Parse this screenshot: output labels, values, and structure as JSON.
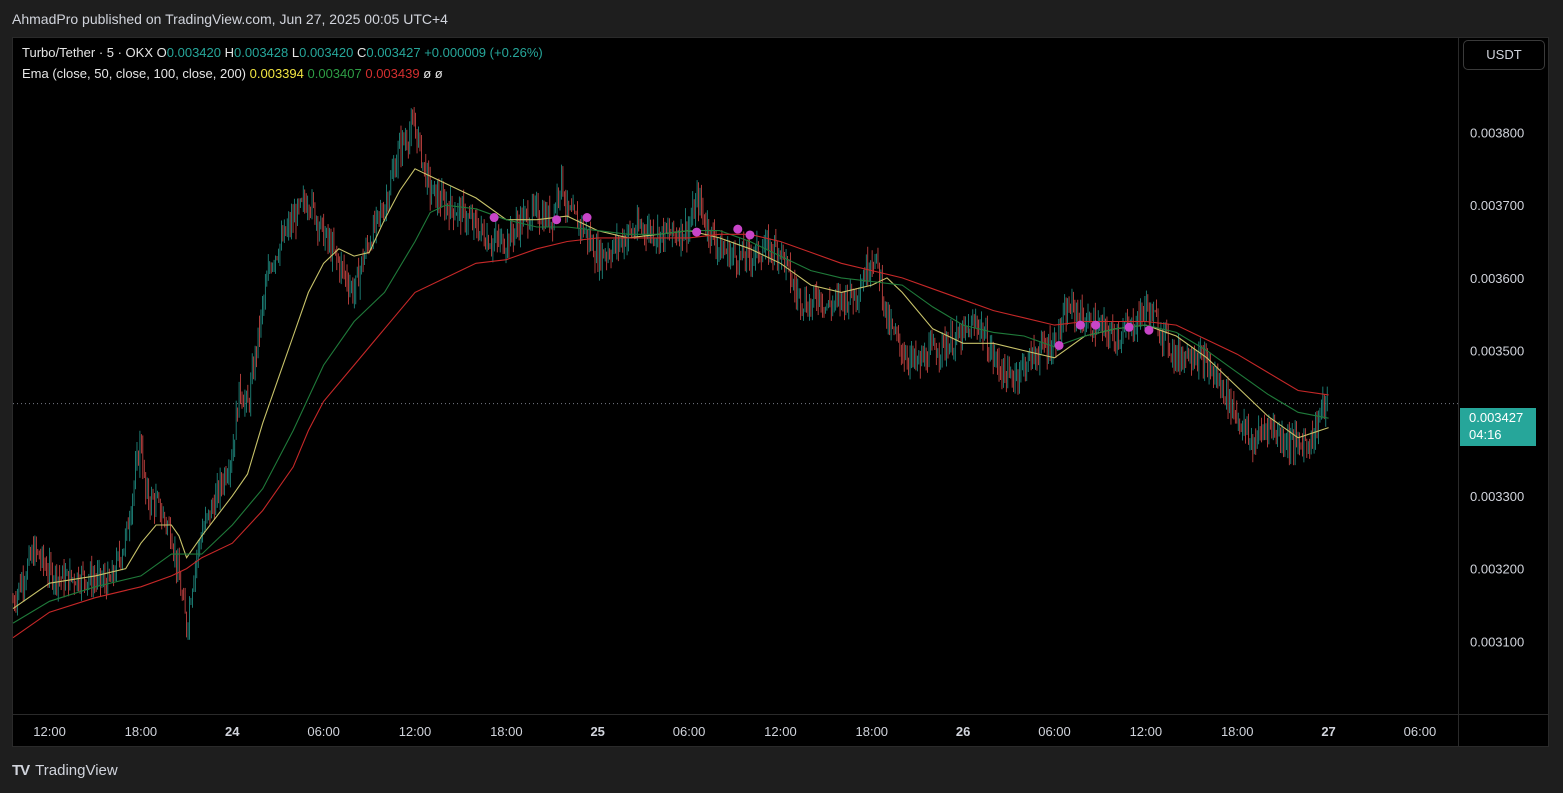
{
  "header": {
    "published": "AhmadPro published on TradingView.com, Jun 27, 2025 00:05 UTC+4"
  },
  "legend": {
    "symbol": "Turbo/Tether · 5 · OKX",
    "o_label": "O",
    "o_val": "0.003420",
    "h_label": "H",
    "h_val": "0.003428",
    "l_label": "L",
    "l_val": "0.003420",
    "c_label": "C",
    "c_val": "0.003427",
    "change": "+0.000009 (+0.26%)",
    "ema_label": "Ema (close, 50, close, 100, close, 200)",
    "ema50": "0.003394",
    "ema100": "0.003407",
    "ema200": "0.003439",
    "extra1": "ø",
    "extra2": "ø"
  },
  "currency_button": "USDT",
  "price_tag": {
    "price": "0.003427",
    "countdown": "04:16"
  },
  "footer": {
    "logo": "TV",
    "brand": "TradingView"
  },
  "colors": {
    "up": "#26a69a",
    "down": "#ef5350",
    "ema50": "#c8c36a",
    "ema100": "#1f7a3a",
    "ema200": "#c62828",
    "marker": "#c845c8",
    "background": "#000000"
  },
  "chart_data": {
    "type": "line",
    "title": "Turbo/Tether · 5 · OKX",
    "y_ticks": [
      "0.003800",
      "0.003700",
      "0.003600",
      "0.003500",
      "0.003300",
      "0.003200",
      "0.003100"
    ],
    "y_tick_values": [
      0.0038,
      0.0037,
      0.0036,
      0.0035,
      0.0033,
      0.0032,
      0.0031
    ],
    "x_ticks": [
      {
        "label": "12:00",
        "h": 12,
        "bold": false
      },
      {
        "label": "18:00",
        "h": 18,
        "bold": false
      },
      {
        "label": "24",
        "h": 24,
        "bold": true
      },
      {
        "label": "06:00",
        "h": 30,
        "bold": false
      },
      {
        "label": "12:00",
        "h": 36,
        "bold": false
      },
      {
        "label": "18:00",
        "h": 42,
        "bold": false
      },
      {
        "label": "25",
        "h": 48,
        "bold": true
      },
      {
        "label": "06:00",
        "h": 54,
        "bold": false
      },
      {
        "label": "12:00",
        "h": 60,
        "bold": false
      },
      {
        "label": "18:00",
        "h": 66,
        "bold": false
      },
      {
        "label": "26",
        "h": 72,
        "bold": true
      },
      {
        "label": "06:00",
        "h": 78,
        "bold": false
      },
      {
        "label": "12:00",
        "h": 84,
        "bold": false
      },
      {
        "label": "18:00",
        "h": 90,
        "bold": false
      },
      {
        "label": "27",
        "h": 96,
        "bold": true
      },
      {
        "label": "06:00",
        "h": 102,
        "bold": false
      }
    ],
    "x_range_hours": [
      9.6,
      104.5
    ],
    "y_range": [
      0.003,
      0.00393
    ],
    "current_price": 0.003427,
    "close_series": {
      "name": "Price",
      "h": [
        9.6,
        11,
        12,
        13,
        14,
        15,
        16,
        17,
        18,
        18.3,
        19,
        20,
        21,
        21.5,
        22,
        23,
        24,
        24.5,
        25,
        26,
        26.5,
        27,
        28,
        29,
        30,
        31,
        32,
        32.5,
        33,
        34,
        35,
        36,
        36.5,
        37,
        38,
        39,
        40,
        41,
        42,
        43,
        44,
        45,
        45.6,
        46,
        47,
        48,
        49,
        50,
        51,
        52,
        53,
        54,
        54.6,
        55,
        56,
        57,
        58,
        59,
        60,
        61,
        62,
        62.5,
        63,
        64,
        65,
        66,
        66.5,
        67,
        68,
        69,
        70,
        71,
        72,
        73,
        74,
        75,
        76,
        77,
        78,
        79,
        80,
        81,
        82,
        83,
        84,
        85,
        86,
        87,
        88,
        89,
        90,
        91,
        92,
        93,
        94,
        95,
        95.5,
        96
      ],
      "values": [
        0.003155,
        0.003225,
        0.003195,
        0.003185,
        0.00319,
        0.003185,
        0.00318,
        0.00324,
        0.00338,
        0.0033,
        0.00329,
        0.00325,
        0.00312,
        0.0032,
        0.00325,
        0.0033,
        0.00336,
        0.00345,
        0.00342,
        0.00356,
        0.00362,
        0.00364,
        0.00368,
        0.00371,
        0.00366,
        0.00362,
        0.00358,
        0.00362,
        0.00365,
        0.0037,
        0.00378,
        0.00381,
        0.00376,
        0.00372,
        0.0037,
        0.00369,
        0.00367,
        0.00365,
        0.00365,
        0.00368,
        0.00369,
        0.00368,
        0.00374,
        0.00369,
        0.00367,
        0.00363,
        0.00364,
        0.00366,
        0.00367,
        0.00366,
        0.00366,
        0.00367,
        0.00371,
        0.00368,
        0.00364,
        0.00363,
        0.00363,
        0.00364,
        0.00364,
        0.00358,
        0.00356,
        0.00358,
        0.00356,
        0.00357,
        0.00358,
        0.00363,
        0.00361,
        0.00354,
        0.0035,
        0.00348,
        0.0035,
        0.00351,
        0.00352,
        0.00354,
        0.00349,
        0.00346,
        0.00348,
        0.0035,
        0.00351,
        0.00356,
        0.00354,
        0.00353,
        0.00352,
        0.00353,
        0.00356,
        0.00353,
        0.00349,
        0.0035,
        0.00348,
        0.00345,
        0.00341,
        0.00337,
        0.0034,
        0.00338,
        0.00337,
        0.00338,
        0.00342,
        0.003427
      ]
    },
    "series": [
      {
        "name": "EMA 50",
        "h": [
          9.6,
          12,
          15,
          17,
          18,
          19,
          20,
          20.5,
          21,
          22,
          24,
          25,
          26,
          27,
          28,
          29,
          30,
          31,
          32,
          33,
          34,
          35,
          36,
          37,
          38,
          40,
          42,
          44,
          46,
          48,
          50,
          52,
          54,
          56,
          58,
          60,
          62,
          64,
          66,
          67,
          68,
          70,
          72,
          74,
          76,
          78,
          80,
          82,
          84,
          86,
          88,
          90,
          92,
          94,
          96
        ],
        "values": [
          0.003145,
          0.00318,
          0.00319,
          0.0032,
          0.003235,
          0.00326,
          0.00326,
          0.003245,
          0.003215,
          0.003245,
          0.0033,
          0.00333,
          0.0034,
          0.00346,
          0.00352,
          0.00358,
          0.00362,
          0.00364,
          0.00363,
          0.003635,
          0.00368,
          0.00372,
          0.00375,
          0.00374,
          0.00373,
          0.00371,
          0.00368,
          0.00368,
          0.003685,
          0.003665,
          0.003655,
          0.00366,
          0.003665,
          0.003655,
          0.00364,
          0.00362,
          0.00359,
          0.00358,
          0.00359,
          0.0036,
          0.00358,
          0.00353,
          0.00351,
          0.00351,
          0.0035,
          0.00349,
          0.00352,
          0.00353,
          0.003535,
          0.00352,
          0.00349,
          0.00345,
          0.00341,
          0.00338,
          0.003394
        ]
      },
      {
        "name": "EMA 100",
        "h": [
          9.6,
          12,
          15,
          18,
          20,
          21,
          22,
          24,
          26,
          28,
          30,
          32,
          34,
          36,
          37,
          38,
          40,
          42,
          44,
          46,
          48,
          50,
          52,
          54,
          56,
          58,
          60,
          62,
          64,
          66,
          68,
          70,
          72,
          74,
          76,
          78,
          80,
          82,
          84,
          86,
          88,
          90,
          92,
          94,
          96
        ],
        "values": [
          0.003125,
          0.003155,
          0.003175,
          0.00319,
          0.00322,
          0.00322,
          0.00322,
          0.00326,
          0.00331,
          0.00339,
          0.00348,
          0.00354,
          0.00358,
          0.00365,
          0.00369,
          0.0037,
          0.003695,
          0.00368,
          0.00367,
          0.00367,
          0.003665,
          0.00366,
          0.00366,
          0.003665,
          0.003665,
          0.00365,
          0.00363,
          0.00361,
          0.0036,
          0.003595,
          0.00359,
          0.00356,
          0.003535,
          0.003525,
          0.00352,
          0.003505,
          0.00352,
          0.00353,
          0.003535,
          0.003525,
          0.0035,
          0.00347,
          0.00344,
          0.003415,
          0.003407
        ]
      },
      {
        "name": "EMA 200",
        "h": [
          9.6,
          12,
          15,
          18,
          20,
          21,
          22,
          24,
          26,
          28,
          29,
          30,
          32,
          34,
          36,
          38,
          40,
          42,
          44,
          46,
          48,
          50,
          52,
          54,
          56,
          58,
          60,
          62,
          64,
          66,
          68,
          70,
          72,
          74,
          76,
          78,
          80,
          82,
          84,
          86,
          88,
          90,
          92,
          94,
          96
        ],
        "values": [
          0.003105,
          0.00314,
          0.00316,
          0.003175,
          0.00319,
          0.0032,
          0.003215,
          0.003235,
          0.00328,
          0.00334,
          0.00339,
          0.00343,
          0.00348,
          0.00353,
          0.00358,
          0.0036,
          0.00362,
          0.003625,
          0.00364,
          0.00365,
          0.003655,
          0.003655,
          0.003655,
          0.003655,
          0.00366,
          0.00366,
          0.00365,
          0.003635,
          0.00362,
          0.00361,
          0.0036,
          0.003585,
          0.00357,
          0.003555,
          0.003545,
          0.003535,
          0.00354,
          0.00354,
          0.00354,
          0.003535,
          0.003515,
          0.003495,
          0.00347,
          0.003445,
          0.003439
        ]
      }
    ],
    "markers": {
      "h": [
        41.2,
        45.3,
        47.3,
        54.5,
        57.2,
        58.0,
        78.3,
        79.7,
        80.7,
        82.9,
        84.2
      ],
      "values": [
        0.003683,
        0.00368,
        0.003683,
        0.003663,
        0.003667,
        0.003659,
        0.003507,
        0.003535,
        0.003535,
        0.003532,
        0.003528
      ]
    }
  }
}
